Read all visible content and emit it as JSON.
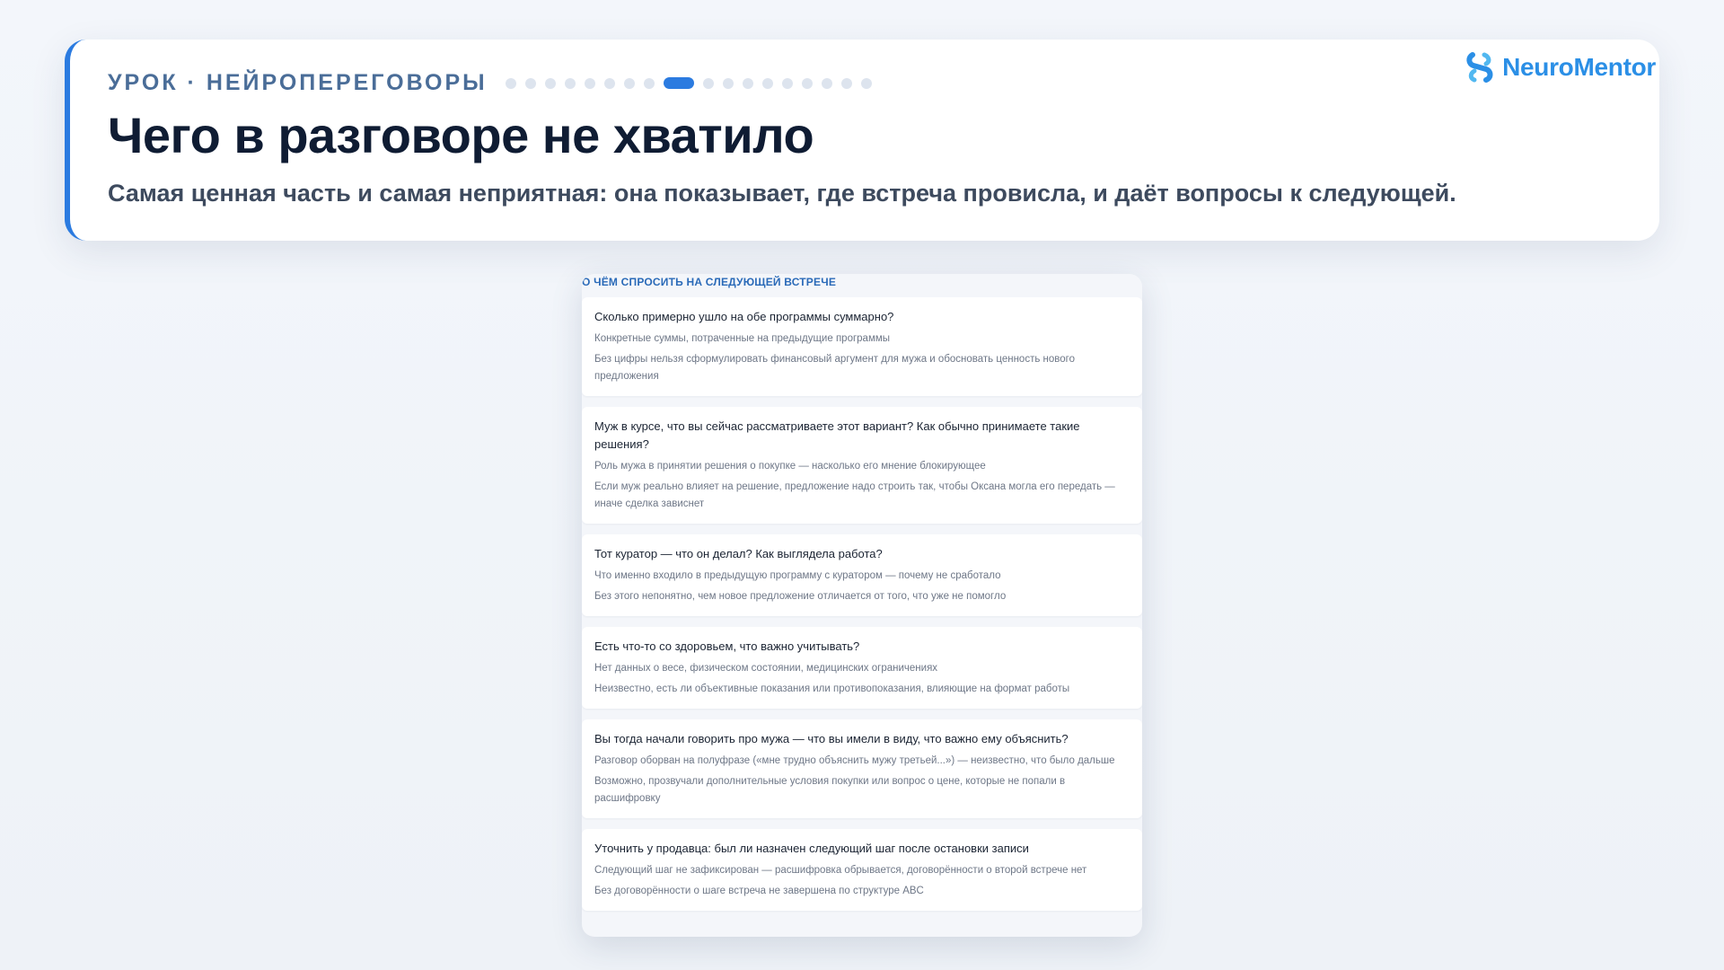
{
  "header": {
    "eyebrow": "УРОК · НЕЙРОПЕРЕГОВОРЫ",
    "title": "Чего в разговоре не хватило",
    "subtitle": "Самая ценная часть и самая неприятная: она показывает, где встреча провисла, и даёт вопросы к следующей.",
    "progress": {
      "total": 18,
      "current": 9
    },
    "accent_color": "#2b7be0"
  },
  "brand": {
    "name": "NeuroMentor",
    "icon": "neuromentor-logo-icon",
    "color": "#2b8fe6"
  },
  "panel": {
    "heading": "О ЧЁМ СПРОСИТЬ НА СЛЕДУЮЩЕЙ ВСТРЕЧЕ",
    "questions": [
      {
        "question": "Сколько примерно ушло на обе программы суммарно?",
        "gap": "Конкретные суммы, потраченные на предыдущие программы",
        "why": "Без цифры нельзя сформулировать финансовый аргумент для мужа и обосновать ценность нового предложения"
      },
      {
        "question": "Муж в курсе, что вы сейчас рассматриваете этот вариант? Как обычно принимаете такие решения?",
        "gap": "Роль мужа в принятии решения о покупке — насколько его мнение блокирующее",
        "why": "Если муж реально влияет на решение, предложение надо строить так, чтобы Оксана могла его передать — иначе сделка зависнет"
      },
      {
        "question": "Тот куратор — что он делал? Как выглядела работа?",
        "gap": "Что именно входило в предыдущую программу с куратором — почему не сработало",
        "why": "Без этого непонятно, чем новое предложение отличается от того, что уже не помогло"
      },
      {
        "question": "Есть что-то со здоровьем, что важно учитывать?",
        "gap": "Нет данных о весе, физическом состоянии, медицинских ограничениях",
        "why": "Неизвестно, есть ли объективные показания или противопоказания, влияющие на формат работы"
      },
      {
        "question": "Вы тогда начали говорить про мужа — что вы имели в виду, что важно ему объяснить?",
        "gap": "Разговор оборван на полуфразе («мне трудно объяснить мужу третьей...») — неизвестно, что было дальше",
        "why": "Возможно, прозвучали дополнительные условия покупки или вопрос о цене, которые не попали в расшифровку"
      },
      {
        "question": "Уточнить у продавца: был ли назначен следующий шаг после остановки записи",
        "gap": "Следующий шаг не зафиксирован — расшифровка обрывается, договорённости о второй встрече нет",
        "why": "Без договорённости о шаге встреча не завершена по структуре ABC"
      }
    ]
  }
}
